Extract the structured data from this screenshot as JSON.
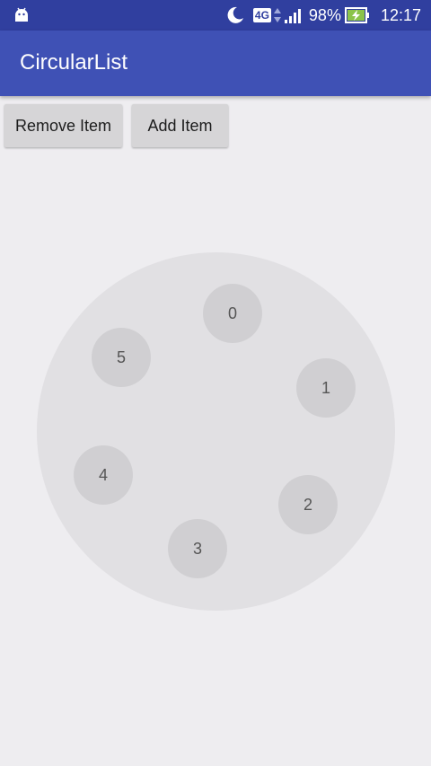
{
  "status_bar": {
    "network_type": "4G",
    "battery_percent": "98%",
    "time": "12:17",
    "icons": [
      "android-icon",
      "moon-icon",
      "signal-icon",
      "battery-charging-icon"
    ]
  },
  "app_bar": {
    "title": "CircularList"
  },
  "buttons": {
    "remove_label": "Remove Item",
    "add_label": "Add Item"
  },
  "circular_list": {
    "items": [
      "0",
      "1",
      "2",
      "3",
      "4",
      "5"
    ]
  },
  "colors": {
    "status_bar": "#303f9f",
    "app_bar": "#3f51b5",
    "background": "#eeedf0",
    "circle": "#e1e0e3",
    "item": "#d0cfd2"
  }
}
